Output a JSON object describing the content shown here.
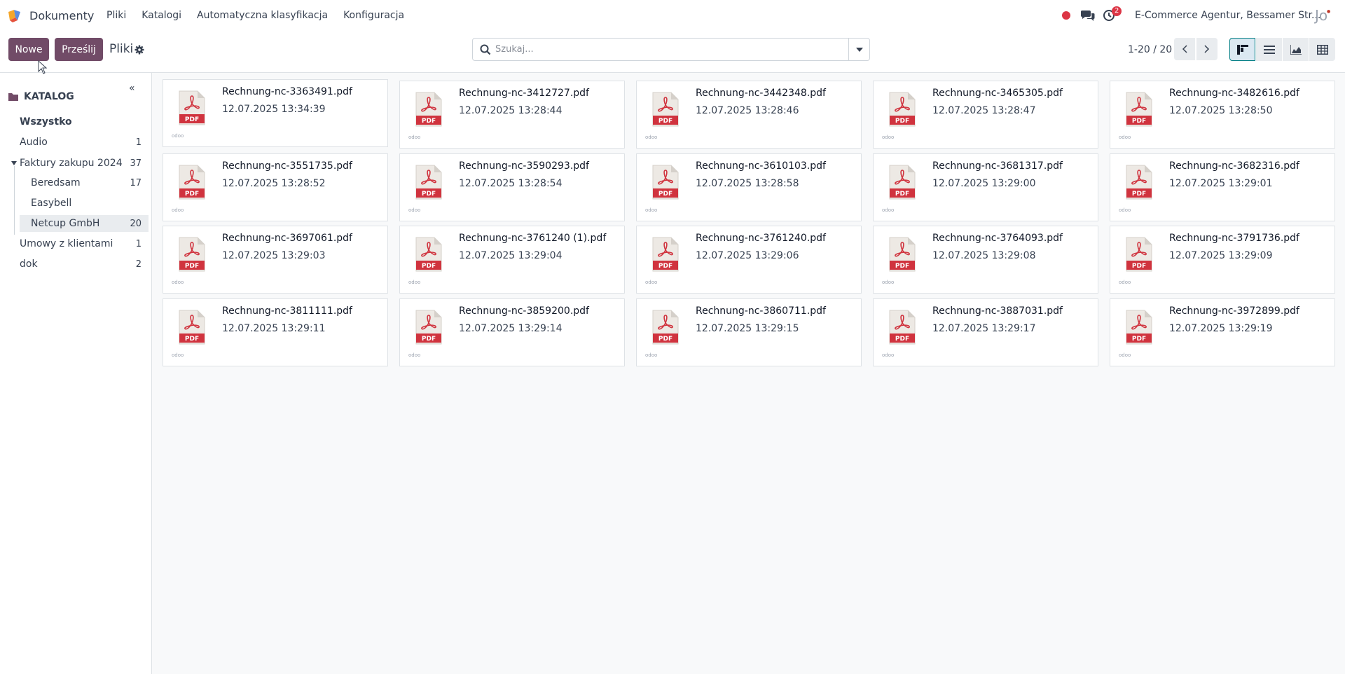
{
  "navbar": {
    "app_name": "Dokumenty",
    "menu": [
      "Pliki",
      "Katalogi",
      "Automatyczna klasyfikacja",
      "Konfiguracja"
    ],
    "activity_count": "2",
    "company": "E-Commerce Agentur, Bessamer Str..."
  },
  "control": {
    "new_label": "Nowe",
    "upload_label": "Prześlij",
    "breadcrumb": "Pliki",
    "search_placeholder": "Szukaj...",
    "pager": "1-20 / 20",
    "views": [
      "kanban",
      "list",
      "graph",
      "pivot"
    ],
    "active_view": "kanban"
  },
  "sidebar": {
    "collapse_label": "«",
    "title": "KATALOG",
    "items": [
      {
        "label": "Wszystko",
        "count": ""
      },
      {
        "label": "Audio",
        "count": "1"
      },
      {
        "label": "Faktury zakupu 2024",
        "count": "37"
      },
      {
        "label": "Beredsam",
        "count": "17"
      },
      {
        "label": "Easybell",
        "count": ""
      },
      {
        "label": "Netcup GmbH",
        "count": "20"
      },
      {
        "label": "Umowy z klientami",
        "count": "1"
      },
      {
        "label": "dok",
        "count": "2"
      }
    ],
    "selected": "Netcup GmbH"
  },
  "files": [
    {
      "name": "Rechnung-nc-3363491.pdf",
      "date": "12.07.2025 13:34:39"
    },
    {
      "name": "Rechnung-nc-3412727.pdf",
      "date": "12.07.2025 13:28:44"
    },
    {
      "name": "Rechnung-nc-3442348.pdf",
      "date": "12.07.2025 13:28:46"
    },
    {
      "name": "Rechnung-nc-3465305.pdf",
      "date": "12.07.2025 13:28:47"
    },
    {
      "name": "Rechnung-nc-3482616.pdf",
      "date": "12.07.2025 13:28:50"
    },
    {
      "name": "Rechnung-nc-3551735.pdf",
      "date": "12.07.2025 13:28:52"
    },
    {
      "name": "Rechnung-nc-3590293.pdf",
      "date": "12.07.2025 13:28:54"
    },
    {
      "name": "Rechnung-nc-3610103.pdf",
      "date": "12.07.2025 13:28:58"
    },
    {
      "name": "Rechnung-nc-3681317.pdf",
      "date": "12.07.2025 13:29:00"
    },
    {
      "name": "Rechnung-nc-3682316.pdf",
      "date": "12.07.2025 13:29:01"
    },
    {
      "name": "Rechnung-nc-3697061.pdf",
      "date": "12.07.2025 13:29:03"
    },
    {
      "name": "Rechnung-nc-3761240 (1).pdf",
      "date": "12.07.2025 13:29:04"
    },
    {
      "name": "Rechnung-nc-3761240.pdf",
      "date": "12.07.2025 13:29:06"
    },
    {
      "name": "Rechnung-nc-3764093.pdf",
      "date": "12.07.2025 13:29:08"
    },
    {
      "name": "Rechnung-nc-3791736.pdf",
      "date": "12.07.2025 13:29:09"
    },
    {
      "name": "Rechnung-nc-3811111.pdf",
      "date": "12.07.2025 13:29:11"
    },
    {
      "name": "Rechnung-nc-3859200.pdf",
      "date": "12.07.2025 13:29:14"
    },
    {
      "name": "Rechnung-nc-3860711.pdf",
      "date": "12.07.2025 13:29:15"
    },
    {
      "name": "Rechnung-nc-3887031.pdf",
      "date": "12.07.2025 13:29:17"
    },
    {
      "name": "Rechnung-nc-3972899.pdf",
      "date": "12.07.2025 13:29:19"
    }
  ],
  "pdf_label": "PDF",
  "card_tag": "odoo",
  "colors": {
    "primary": "#714b67",
    "pdf_red": "#d0333e",
    "badge_red": "#dc3545",
    "active_view": "#017e84"
  }
}
